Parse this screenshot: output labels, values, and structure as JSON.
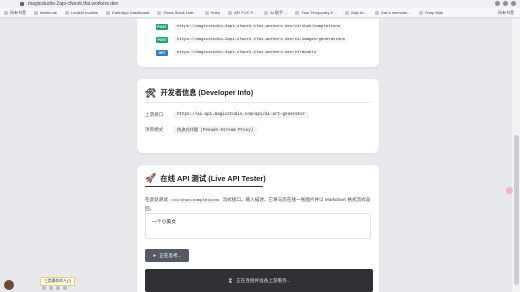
{
  "browser": {
    "url": "magicstudio-2api-cfwork.tfai.workers.dev",
    "bookmarks": [
      "所有书签",
      "ikhskt.cat",
      "LocalAI models",
      "EarthApp Dashboard",
      "Gloss Stack Hub...",
      "Hubo",
      "AFI FUC F...",
      "AI 助手 ...",
      "Your Temporary E...",
      "Gapi Al...",
      "Gat a memorie...",
      "Temp Mail"
    ],
    "bookmarks_right": "所有书签"
  },
  "endpoints": [
    {
      "method": "POST",
      "path": "https://magicstudio-2api-cfwork.tfai.workers.dev/v1/chat/completions"
    },
    {
      "method": "POST",
      "path": "https://magicstudio-2api-cfwork.tfai.workers.dev/v1/images/generations"
    },
    {
      "method": "GET",
      "path": "https://magicstudio-2api-cfwork.tfai.workers.dev/v1/models"
    }
  ],
  "developer": {
    "title": "开发者信息 (Developer Info)",
    "upstream_label": "上游接口",
    "upstream_value": "https://ai-api.magicstudio.com/api/ai-art-generator",
    "mode_label": "项目模式",
    "mode_value": "伪流式代理 (Pseudo-Stream Proxy)"
  },
  "tester": {
    "title": "在线 API 测试 (Live API Tester)",
    "desc_prefix": "在此处测试",
    "desc_code": "/v1/chat/completions",
    "desc_suffix": "流式接口。输入描述，它将与您在线一张图片并以 Markdown 格式流式返回。",
    "prompt_value": "一个小美女",
    "button_label": "正在思考...",
    "status_text": "正在连接并准备上游服务..."
  },
  "taskbar": {
    "tab_label": "三类操作的人(7)"
  },
  "colors": {
    "post": "#22a06b",
    "get": "#2f7fbf",
    "button": "#555a63",
    "result_bg": "#2f3135"
  }
}
